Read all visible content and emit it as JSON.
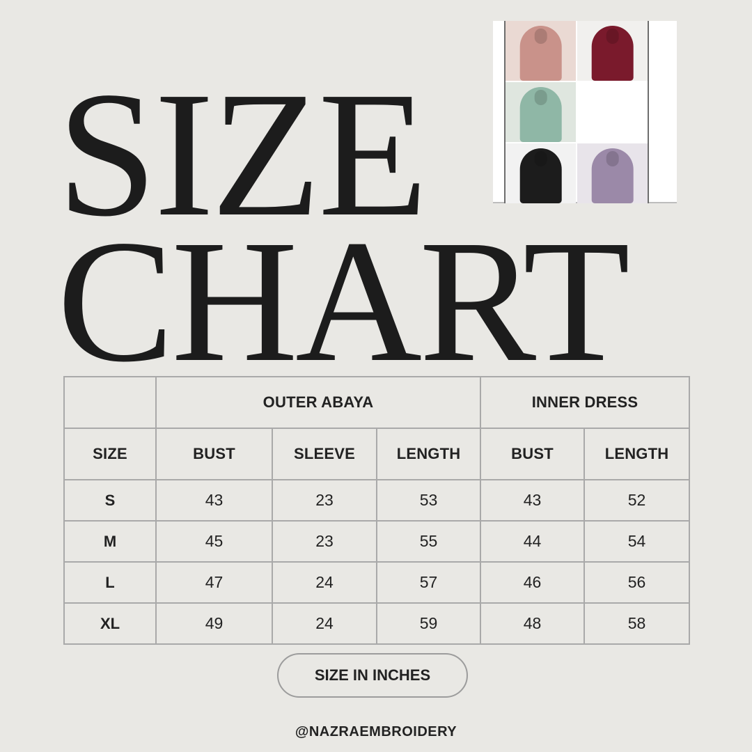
{
  "title": {
    "line1": "SIZE",
    "line2": "CHART"
  },
  "photos": [
    {
      "name": "pink-abaya-photo",
      "color": "#c9928a",
      "bg": "#ead9d3"
    },
    {
      "name": "maroon-abaya-photo",
      "color": "#7a1a2c",
      "bg": "#f1f0ee"
    },
    {
      "name": "green-abaya-photo",
      "color": "#8fb7a6",
      "bg": "#dfe6df"
    },
    {
      "name": "blank-photo",
      "color": "#ffffff",
      "bg": "#ffffff"
    },
    {
      "name": "black-abaya-photo",
      "color": "#1c1c1c",
      "bg": "#f2f2f2"
    },
    {
      "name": "lilac-abaya-photo",
      "color": "#9b89a8",
      "bg": "#e8e4ea"
    }
  ],
  "table": {
    "group_headers": {
      "outer": "OUTER ABAYA",
      "inner": "INNER DRESS"
    },
    "columns": [
      "SIZE",
      "BUST",
      "SLEEVE",
      "LENGTH",
      "BUST",
      "LENGTH"
    ],
    "rows": [
      {
        "size": "S",
        "values": [
          "43",
          "23",
          "53",
          "43",
          "52"
        ]
      },
      {
        "size": "M",
        "values": [
          "45",
          "23",
          "55",
          "44",
          "54"
        ]
      },
      {
        "size": "L",
        "values": [
          "47",
          "24",
          "57",
          "46",
          "56"
        ]
      },
      {
        "size": "XL",
        "values": [
          "49",
          "24",
          "59",
          "48",
          "58"
        ]
      }
    ]
  },
  "unit_note": "SIZE IN INCHES",
  "handle": "@NAZRAEMBROIDERY"
}
